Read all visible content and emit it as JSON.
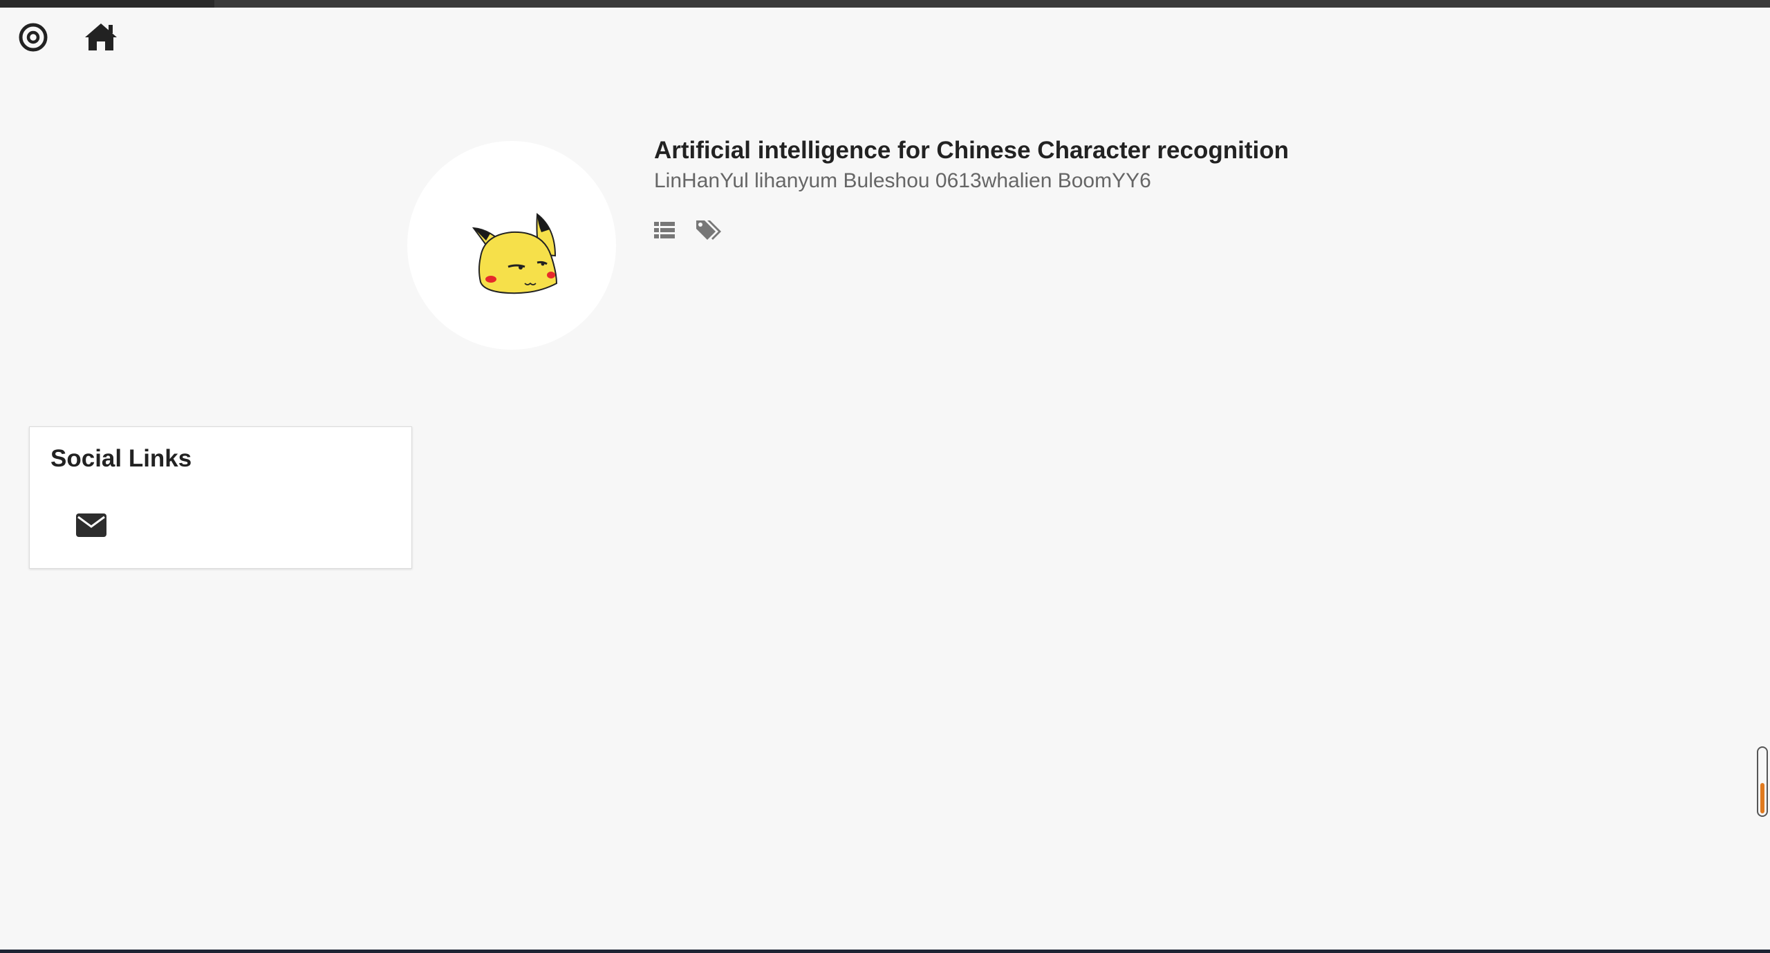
{
  "nav": {
    "target_icon": "target-icon",
    "home_icon": "home-icon"
  },
  "project": {
    "title": "Artificial intelligence for Chinese Character recognition",
    "authors": "LinHanYul lihanyum Buleshou 0613whalien BoomYY6",
    "avatar": "pikachu-avatar",
    "list_icon": "list-icon",
    "tags_icon": "tags-icon"
  },
  "social": {
    "heading": "Social Links",
    "email_icon": "envelope-icon"
  },
  "scroll_indicator": {
    "fill_fraction": 0.45,
    "fill_color": "#e07a1f"
  }
}
